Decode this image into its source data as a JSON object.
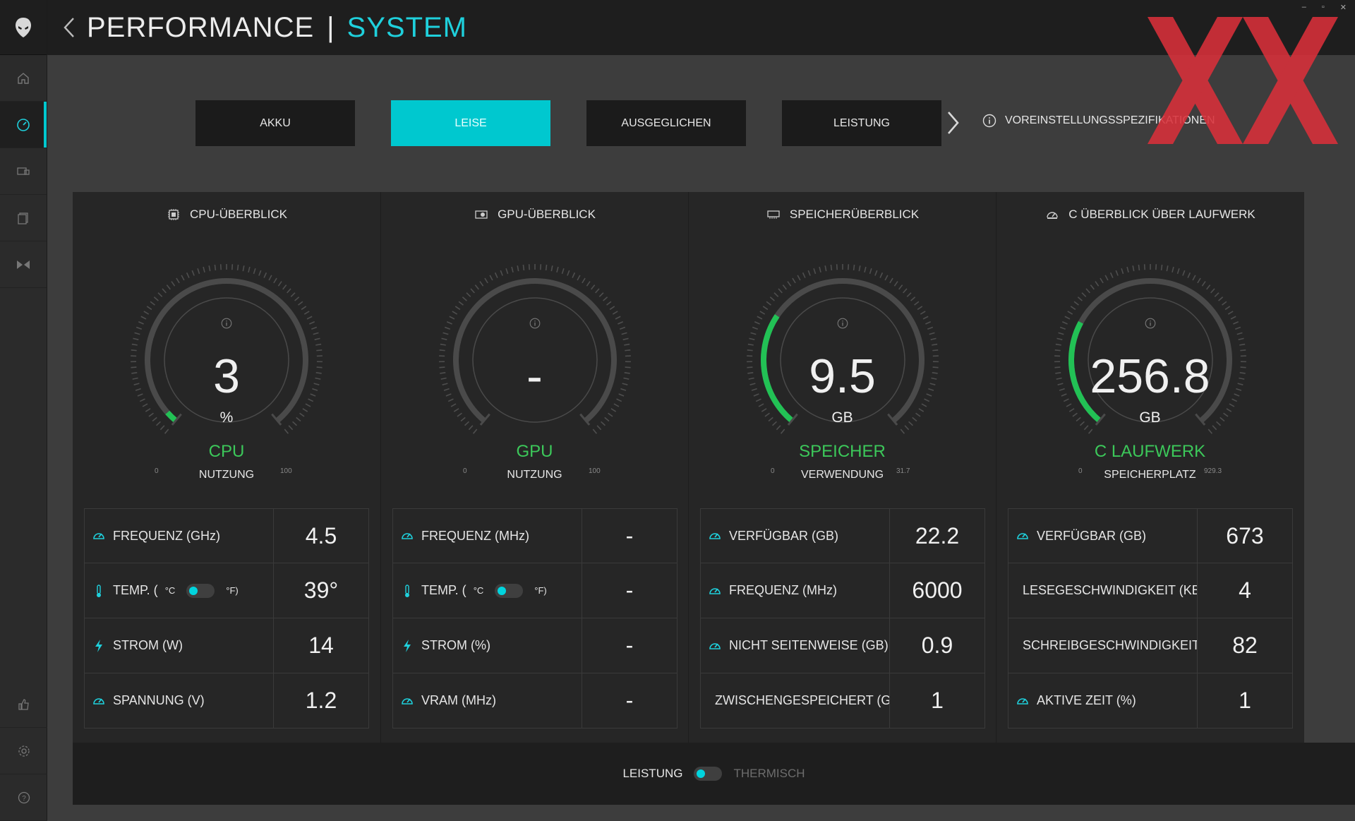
{
  "header": {
    "title": "PERFORMANCE",
    "separator": "|",
    "subtitle": "SYSTEM",
    "subtitle_color": "#1fd0dc"
  },
  "window_controls": [
    "–",
    "▫",
    "✕"
  ],
  "presets": {
    "items": [
      {
        "label": "AKKU",
        "active": false
      },
      {
        "label": "LEISE",
        "active": true
      },
      {
        "label": "AUSGEGLICHEN",
        "active": false
      },
      {
        "label": "LEISTUNG",
        "active": false
      }
    ],
    "spec_label": "VOREINSTELLUNGSSPEZIFIKATIONEN",
    "accent": "#00c8cf"
  },
  "sidebar": {
    "items": [
      {
        "icon": "home-icon"
      },
      {
        "icon": "speedometer-icon",
        "active": true
      },
      {
        "icon": "controller-icon"
      },
      {
        "icon": "library-icon"
      },
      {
        "icon": "macro-icon"
      }
    ],
    "bottom": [
      {
        "icon": "thumbs-up-icon"
      },
      {
        "icon": "gear-icon"
      },
      {
        "icon": "help-icon"
      }
    ]
  },
  "columns": [
    {
      "header": "CPU-ÜBERBLICK",
      "icon": "cpu-icon",
      "gauge": {
        "value": "3",
        "unit": "%",
        "label": "CPU",
        "sublabel": "NUTZUNG",
        "min": "0",
        "max": "100",
        "fraction": 0.03
      },
      "stats": [
        {
          "icon": "gauge-icon",
          "label": "FREQUENZ (GHz)",
          "value": "4.5"
        },
        {
          "icon": "thermometer-icon",
          "label": "TEMP. (",
          "unit_c": "°C",
          "unit_f": "°F)",
          "value": "39°",
          "toggle": true
        },
        {
          "icon": "bolt-icon",
          "label": "STROM (W)",
          "value": "14"
        },
        {
          "icon": "gauge-icon",
          "label": "SPANNUNG (V)",
          "value": "1.2"
        }
      ]
    },
    {
      "header": "GPU-ÜBERBLICK",
      "icon": "gpu-icon",
      "gauge": {
        "value": "-",
        "unit": "",
        "label": "GPU",
        "sublabel": "NUTZUNG",
        "min": "0",
        "max": "100",
        "fraction": 0
      },
      "stats": [
        {
          "icon": "gauge-icon",
          "label": "FREQUENZ (MHz)",
          "value": "-"
        },
        {
          "icon": "thermometer-icon",
          "label": "TEMP. (",
          "unit_c": "°C",
          "unit_f": "°F)",
          "value": "-",
          "toggle": true
        },
        {
          "icon": "bolt-icon",
          "label": "STROM (%)",
          "value": "-"
        },
        {
          "icon": "gauge-icon",
          "label": "VRAM (MHz)",
          "value": "-"
        }
      ]
    },
    {
      "header": "SPEICHERÜBERBLICK",
      "icon": "memory-icon",
      "gauge": {
        "value": "9.5",
        "unit": "GB",
        "label": "SPEICHER",
        "sublabel": "VERWENDUNG",
        "min": "0",
        "max": "31.7",
        "fraction": 0.3
      },
      "stats": [
        {
          "icon": "gauge-icon",
          "label": "VERFÜGBAR (GB)",
          "value": "22.2"
        },
        {
          "icon": "gauge-icon",
          "label": "FREQUENZ (MHz)",
          "value": "6000"
        },
        {
          "icon": "gauge-icon",
          "label": "NICHT SEITENWEISE (GB)",
          "value": "0.9"
        },
        {
          "icon": "gauge-icon",
          "label": "ZWISCHENGESPEICHERT (GB)",
          "value": "1"
        }
      ]
    },
    {
      "header": "C ÜBERBLICK ÜBER LAUFWERK",
      "icon": "drive-icon",
      "gauge": {
        "value": "256.8",
        "unit": "GB",
        "label": "C LAUFWERK",
        "sublabel": "SPEICHERPLATZ",
        "min": "0",
        "max": "929.3",
        "fraction": 0.28
      },
      "stats": [
        {
          "icon": "gauge-icon",
          "label": "VERFÜGBAR (GB)",
          "value": "673"
        },
        {
          "icon": "gauge-icon",
          "label": "LESEGESCHWINDIGKEIT (KB/s)",
          "value": "4"
        },
        {
          "icon": "gauge-icon",
          "label": "SCHREIBGESCHWINDIGKEIT (KB/s)",
          "value": "82"
        },
        {
          "icon": "gauge-icon",
          "label": "AKTIVE ZEIT (%)",
          "value": "1"
        }
      ]
    }
  ],
  "footer": {
    "left_label": "LEISTUNG",
    "right_label": "THERMISCH"
  },
  "colors": {
    "accent": "#00c8cf",
    "gauge_fill": "#22c155",
    "gauge_label": "#3cc85a"
  }
}
